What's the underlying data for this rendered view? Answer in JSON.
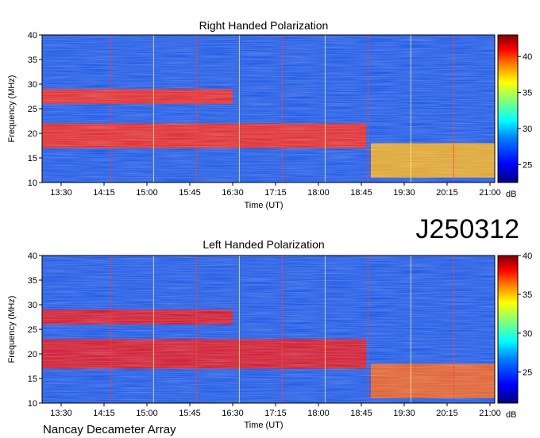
{
  "figure": {
    "date_code": "J250312",
    "instrument": "Nancay Decameter Array"
  },
  "chart_data": [
    {
      "type": "heatmap",
      "title": "Right Handed Polarization",
      "xlabel": "Time (UT)",
      "ylabel": "Frequency (MHz)",
      "x_ticks": [
        "13:30",
        "14:15",
        "15:00",
        "15:45",
        "16:30",
        "17:15",
        "18:00",
        "18:45",
        "19:30",
        "20:15",
        "21:00"
      ],
      "xlim": [
        "13:10",
        "21:05"
      ],
      "y_ticks": [
        10,
        15,
        20,
        25,
        30,
        35,
        40
      ],
      "ylim": [
        10,
        40
      ],
      "colorbar": {
        "label": "dB",
        "ticks": [
          25,
          30,
          35,
          40
        ],
        "range": [
          22.5,
          43
        ]
      },
      "colormap": [
        "#00007f",
        "#0000ff",
        "#007fff",
        "#00ffff",
        "#7fff7f",
        "#ffff00",
        "#ff7f00",
        "#ff0000",
        "#7f0000"
      ],
      "emission_bands": [
        {
          "freq_mhz": [
            17,
            22
          ],
          "time": [
            "13:10",
            "18:50"
          ],
          "db": 40
        },
        {
          "freq_mhz": [
            26,
            29
          ],
          "time": [
            "13:10",
            "16:30"
          ],
          "db": 40
        },
        {
          "freq_mhz": [
            11,
            18
          ],
          "time": [
            "18:55",
            "21:05"
          ],
          "db": 37
        }
      ]
    },
    {
      "type": "heatmap",
      "title": "Left Handed Polarization",
      "xlabel": "Time (UT)",
      "ylabel": "Frequency (MHz)",
      "x_ticks": [
        "13:30",
        "14:15",
        "15:00",
        "15:45",
        "16:30",
        "17:15",
        "18:00",
        "18:45",
        "19:30",
        "20:15",
        "21:00"
      ],
      "xlim": [
        "13:10",
        "21:05"
      ],
      "y_ticks": [
        10,
        15,
        20,
        25,
        30,
        35,
        40
      ],
      "ylim": [
        10,
        40
      ],
      "colorbar": {
        "label": "dB",
        "ticks": [
          25,
          30,
          35,
          40
        ],
        "range": [
          21,
          40
        ]
      },
      "colormap": [
        "#00007f",
        "#0000ff",
        "#007fff",
        "#00ffff",
        "#7fff7f",
        "#ffff00",
        "#ff7f00",
        "#ff0000",
        "#7f0000"
      ],
      "emission_bands": [
        {
          "freq_mhz": [
            17,
            23
          ],
          "time": [
            "13:10",
            "18:50"
          ],
          "db": 38
        },
        {
          "freq_mhz": [
            26,
            29
          ],
          "time": [
            "13:10",
            "16:30"
          ],
          "db": 38
        },
        {
          "freq_mhz": [
            11,
            18
          ],
          "time": [
            "18:55",
            "21:05"
          ],
          "db": 36
        }
      ]
    }
  ]
}
